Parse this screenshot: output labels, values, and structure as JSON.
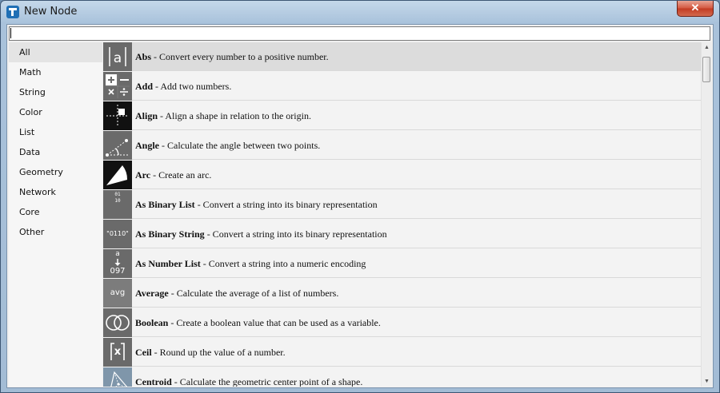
{
  "window": {
    "title": "New Node",
    "close_glyph": "✕"
  },
  "search": {
    "value": "",
    "placeholder": ""
  },
  "sidebar": {
    "items": [
      {
        "label": "All",
        "selected": true
      },
      {
        "label": "Math"
      },
      {
        "label": "String"
      },
      {
        "label": "Color"
      },
      {
        "label": "List"
      },
      {
        "label": "Data"
      },
      {
        "label": "Geometry"
      },
      {
        "label": "Network"
      },
      {
        "label": "Core"
      },
      {
        "label": "Other"
      }
    ]
  },
  "nodes": [
    {
      "name": "Abs",
      "desc": " - Convert every number to a positive number.",
      "icon": "abs-icon",
      "selected": true
    },
    {
      "name": "Add",
      "desc": " - Add two numbers.",
      "icon": "math-operators-icon"
    },
    {
      "name": "Align",
      "desc": " - Align a shape in relation to the origin.",
      "icon": "align-icon"
    },
    {
      "name": "Angle",
      "desc": " - Calculate the angle between two points.",
      "icon": "angle-icon"
    },
    {
      "name": "Arc",
      "desc": " - Create an arc.",
      "icon": "arc-icon"
    },
    {
      "name": "As Binary List",
      "desc": " - Convert a string into its binary representation",
      "icon": "binary-list-icon",
      "icon_text": "0110"
    },
    {
      "name": "As Binary String",
      "desc": " - Convert a string into its binary representation",
      "icon": "binary-string-icon",
      "icon_text": "\"0110\""
    },
    {
      "name": "As Number List",
      "desc": " - Convert a string into a numeric encoding",
      "icon": "number-list-icon",
      "icon_text_top": "a",
      "icon_text_bottom": "097"
    },
    {
      "name": "Average",
      "desc": " - Calculate the average of a list of numbers.",
      "icon": "average-icon",
      "icon_text": "avg"
    },
    {
      "name": "Boolean",
      "desc": " - Create a boolean value that can be used as a variable.",
      "icon": "boolean-icon"
    },
    {
      "name": "Ceil",
      "desc": " - Round up the value of a number.",
      "icon": "ceil-icon",
      "icon_text": "x"
    },
    {
      "name": "Centroid",
      "desc": " - Calculate the geometric center point of a shape.",
      "icon": "centroid-icon"
    }
  ],
  "colors": {
    "selected_row": "#dcdcdc",
    "icon_gray": "#6a6a6a",
    "close_red": "#c23a22"
  }
}
